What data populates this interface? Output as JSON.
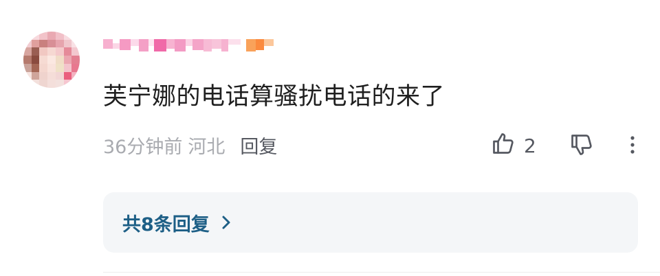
{
  "comment": {
    "text": "芙宁娜的电话算骚扰电话的来了",
    "time": "36分钟前",
    "location": "河北",
    "reply_label": "回复",
    "like_count": "2",
    "replies_link": "共8条回复"
  },
  "colors": {
    "text_primary": "#1f1f1f",
    "text_muted": "#a9abb0",
    "text_action": "#555860",
    "reply_link": "#1d5f86",
    "reply_box_bg": "#f4f6f8"
  },
  "icons": {
    "like": "thumbs-up-icon",
    "dislike": "thumbs-down-icon",
    "more": "more-vertical-icon",
    "chevron": "chevron-right-icon"
  }
}
